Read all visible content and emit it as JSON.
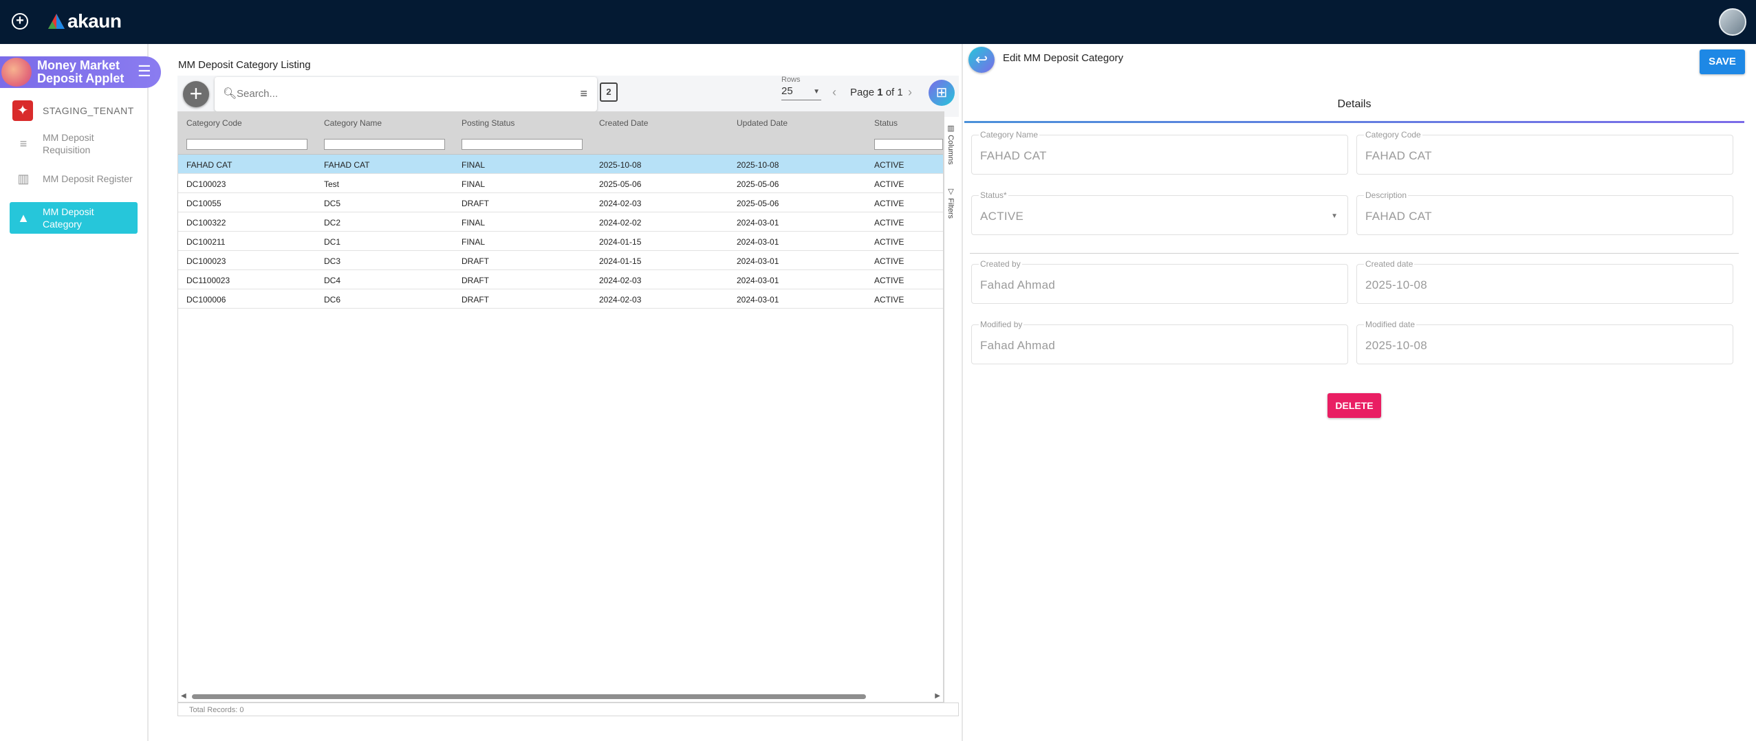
{
  "topbar": {
    "brand": "akaun",
    "add_icon": "plus-circle-icon",
    "avatar_icon": "user-avatar"
  },
  "sidebar": {
    "applet_title": "Money Market Deposit Applet",
    "tenant": "STAGING_TENANT",
    "items": [
      {
        "label": "MM Deposit Requisition",
        "icon": "list-icon"
      },
      {
        "label": "MM Deposit Register",
        "icon": "bar-chart-icon"
      },
      {
        "label": "MM Deposit Category",
        "icon": "category-icon",
        "active": true
      }
    ]
  },
  "listing": {
    "title": "MM Deposit Category Listing",
    "search_placeholder": "Search...",
    "rows_label": "Rows",
    "rows_value": "25",
    "page_prefix": "Page ",
    "page_current": "1",
    "page_suffix": " of 1",
    "columns": [
      "Category Code",
      "Category Name",
      "Posting Status",
      "Created Date",
      "Updated Date",
      "Status"
    ],
    "rows": [
      [
        "FAHAD CAT",
        "FAHAD CAT",
        "FINAL",
        "2025-10-08",
        "2025-10-08",
        "ACTIVE"
      ],
      [
        "DC100023",
        "Test",
        "FINAL",
        "2025-05-06",
        "2025-05-06",
        "ACTIVE"
      ],
      [
        "DC10055",
        "DC5",
        "DRAFT",
        "2024-02-03",
        "2025-05-06",
        "ACTIVE"
      ],
      [
        "DC100322",
        "DC2",
        "FINAL",
        "2024-02-02",
        "2024-03-01",
        "ACTIVE"
      ],
      [
        "DC100211",
        "DC1",
        "FINAL",
        "2024-01-15",
        "2024-03-01",
        "ACTIVE"
      ],
      [
        "DC100023",
        "DC3",
        "DRAFT",
        "2024-01-15",
        "2024-03-01",
        "ACTIVE"
      ],
      [
        "DC1100023",
        "DC4",
        "DRAFT",
        "2024-02-03",
        "2024-03-01",
        "ACTIVE"
      ],
      [
        "DC100006",
        "DC6",
        "DRAFT",
        "2024-02-03",
        "2024-03-01",
        "ACTIVE"
      ]
    ],
    "side_tabs": {
      "columns": "Columns",
      "filters": "Filters"
    },
    "footer": "Total Records: 0"
  },
  "edit": {
    "title": "Edit MM Deposit Category",
    "save_label": "SAVE",
    "tab": "Details",
    "fields": {
      "category_name": {
        "label": "Category Name",
        "value": "FAHAD CAT"
      },
      "category_code": {
        "label": "Category Code",
        "value": "FAHAD CAT"
      },
      "status": {
        "label": "Status*",
        "value": "ACTIVE"
      },
      "description": {
        "label": "Description",
        "value": "FAHAD CAT"
      },
      "created_by": {
        "label": "Created by",
        "value": "Fahad Ahmad"
      },
      "created_date": {
        "label": "Created date",
        "value": "2025-10-08"
      },
      "modified_by": {
        "label": "Modified by",
        "value": "Fahad Ahmad"
      },
      "modified_date": {
        "label": "Modified date",
        "value": "2025-10-08"
      }
    },
    "delete_label": "DELETE"
  },
  "colors": {
    "topbar": "#041a33",
    "applet_header": "#7b6be8",
    "active_nav": "#26c6da",
    "selected_row": "#b7e1f7",
    "save": "#1e88e5",
    "delete": "#e91e63"
  }
}
